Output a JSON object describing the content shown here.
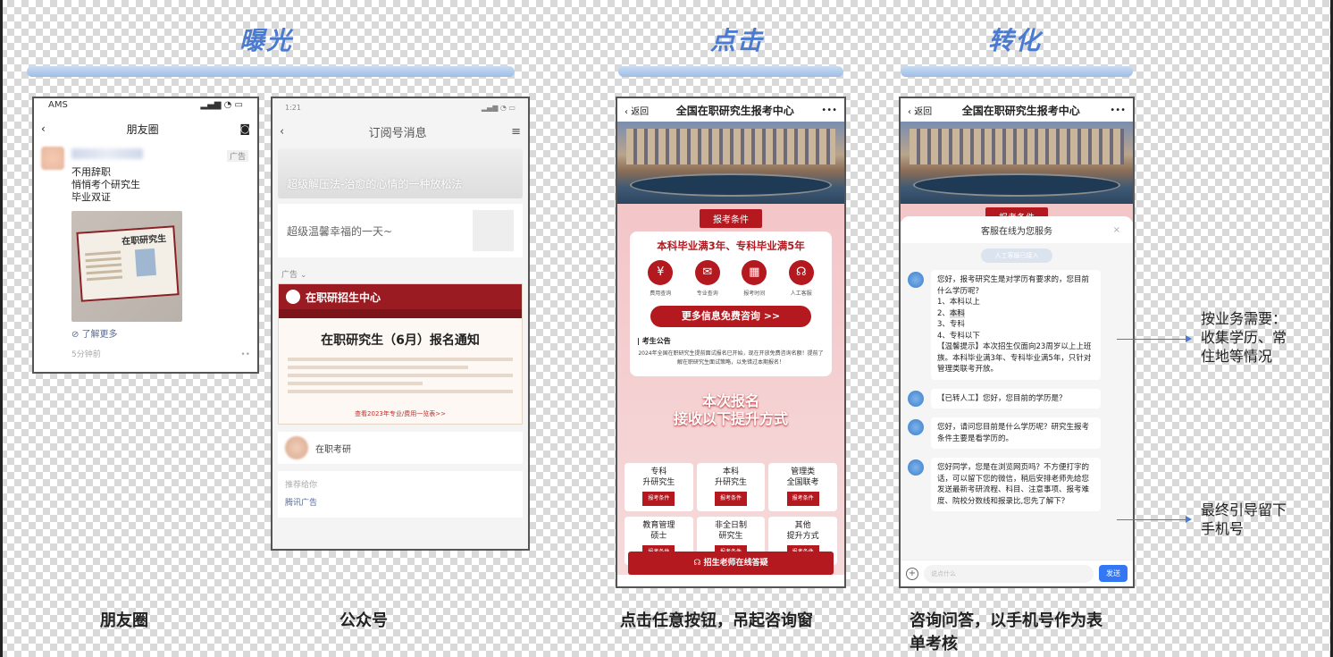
{
  "stages": {
    "exposure": "曝光",
    "click": "点击",
    "convert": "转化"
  },
  "captions": {
    "moments": "朋友圈",
    "official": "公众号",
    "click_any": "点击任意按钮，吊起咨询窗",
    "consult_line1": "咨询问答，以手机号作为表",
    "consult_line2": "单考核"
  },
  "notes": {
    "collect_line1": "按业务需要：",
    "collect_line2": "收集学历、常",
    "collect_line3": "住地等情况",
    "phone_line1": "最终引导留下",
    "phone_line2": "手机号"
  },
  "phone1": {
    "carrier": "AMS",
    "status_icons": "▂▄▆ ◔ ▭",
    "title": "朋友圈",
    "ad_tag": "广告",
    "text_lines": [
      "不用辞职",
      "悄悄考个研究生",
      "毕业双证"
    ],
    "cert_title": "在职研究生",
    "learn_more": "了解更多",
    "time": "5分钟前",
    "more": "••"
  },
  "phone2": {
    "time": "1:21",
    "title": "订阅号消息",
    "banner": "超级解压法-治愈的心情的一种放松法",
    "card_text": "超级温馨幸福的一天~",
    "ad_tag": "广告",
    "ad_brand": "在职研招生中心",
    "ad_title": "在职研究生（6月）报名通知",
    "ad_link": "查看2023年专业/费用一览表>>",
    "account": "在职考研",
    "foot1": "推荐给你",
    "foot2": "腾讯广告"
  },
  "phone3": {
    "back": "返回",
    "title": "全国在职研究生报考中心",
    "more": "•••",
    "tag": "报考条件",
    "headline": "本科毕业满3年、专科毕业满5年",
    "icons": [
      {
        "glyph": "¥",
        "label": "费用查询"
      },
      {
        "glyph": "✉",
        "label": "专业查询"
      },
      {
        "glyph": "▦",
        "label": "报考时间"
      },
      {
        "glyph": "☊",
        "label": "人工客服"
      }
    ],
    "cta": "更多信息免费咨询 >>",
    "notice_title": "考生公告",
    "notice_text": "2024年全国在职研究生提前面试报名已开始，现在开放免费咨询名额！提前了解在职研究生面试策略，以免错过本期报名！",
    "big_line1": "本次报名",
    "big_line2": "接收以下提升方式",
    "grid": [
      {
        "l1": "专科",
        "l2": "升研究生",
        "btn": "报考条件"
      },
      {
        "l1": "本科",
        "l2": "升研究生",
        "btn": "报考条件"
      },
      {
        "l1": "管理类",
        "l2": "全国联考",
        "btn": "报考条件"
      },
      {
        "l1": "教育管理",
        "l2": "硕士",
        "btn": "报考条件"
      },
      {
        "l1": "非全日制",
        "l2": "研究生",
        "btn": "报考条件"
      },
      {
        "l1": "其他",
        "l2": "提升方式",
        "btn": "报考条件"
      }
    ],
    "footer": "招生老师在线答疑"
  },
  "phone4": {
    "back": "返回",
    "title": "全国在职研究生报考中心",
    "more": "•••",
    "tag": "报考条件",
    "chat_title": "客服在线为您服务",
    "close": "×",
    "pill": "人工客服已接入",
    "msg1": {
      "intro": "您好，报考研究生是对学历有要求的，您目前什么学历呢？",
      "opt1": "1、本科以上",
      "opt2_prefix": "2、",
      "opt2": "本科",
      "opt3": "3、专科",
      "opt4": "4、专科以下",
      "tip": "【温馨提示】本次招生仅面向23周岁以上上班族。本科毕业满3年、专科毕业满5年，只针对管理类联考开放。"
    },
    "msg2": "【已转人工】您好，您目前的学历是？",
    "msg3": "您好，请问您目前是什么学历呢？研究生报考条件主要是看学历的。",
    "msg4": "您好同学，您是在浏览网页吗？不方便打字的话，可以留下您的微信，稍后安排老师先给您发送最新考研流程、科目、注意事项、报考难度、院校分数线和报录比,您先了解下？",
    "input_placeholder": "说点什么",
    "plus": "+",
    "send": "发送"
  }
}
